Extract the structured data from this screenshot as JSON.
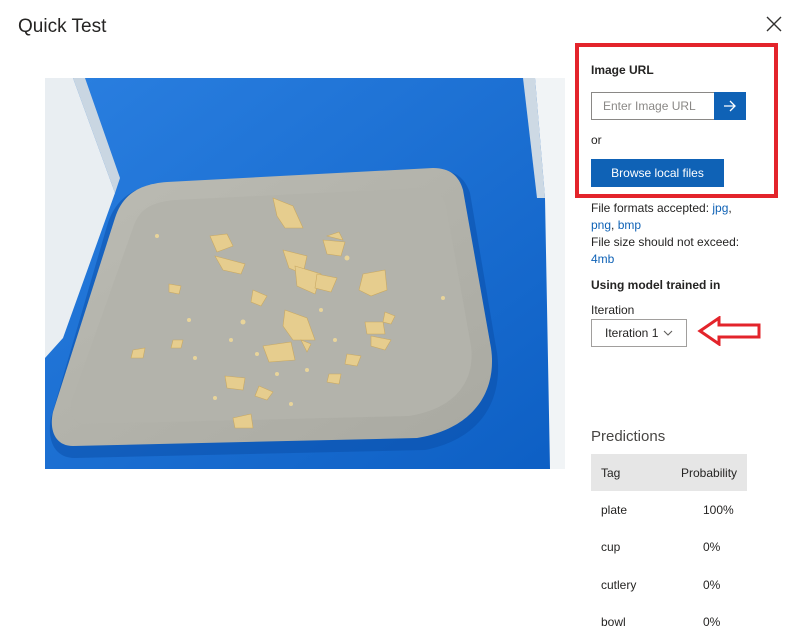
{
  "header": {
    "title": "Quick Test"
  },
  "image_url": {
    "label": "Image URL",
    "placeholder": "Enter Image URL",
    "or_text": "or",
    "browse_label": "Browse local files"
  },
  "file_info": {
    "formats_prefix": "File formats accepted: ",
    "formats": [
      "jpg",
      "png",
      "bmp"
    ],
    "size_prefix": "File size should not exceed: ",
    "size_limit": "4mb"
  },
  "model": {
    "heading": "Using model trained in",
    "iteration_label": "Iteration",
    "iteration_value": "Iteration 1"
  },
  "predictions": {
    "title": "Predictions",
    "columns": [
      "Tag",
      "Probability"
    ],
    "rows": [
      {
        "tag": "plate",
        "probability": "100%"
      },
      {
        "tag": "cup",
        "probability": "0%"
      },
      {
        "tag": "cutlery",
        "probability": "0%"
      },
      {
        "tag": "bowl",
        "probability": "0%"
      }
    ]
  },
  "colors": {
    "primary": "#0f62b6",
    "annotation": "#e3242b",
    "header_bg": "#e6e6e6"
  },
  "icons": [
    "close-icon",
    "arrow-right-icon",
    "chevron-down-icon",
    "annotation-arrow-icon"
  ]
}
